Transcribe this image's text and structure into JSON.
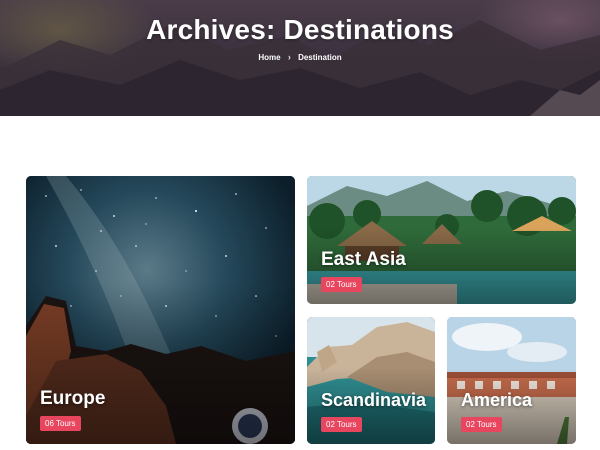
{
  "hero": {
    "title": "Archives: Destinations",
    "breadcrumb": {
      "home": "Home",
      "separator": "›",
      "current": "Destination"
    }
  },
  "destinations": [
    {
      "name": "Europe",
      "tours": "06 Tours"
    },
    {
      "name": "East Asia",
      "tours": "02 Tours"
    },
    {
      "name": "Scandinavia",
      "tours": "02 Tours"
    },
    {
      "name": "America",
      "tours": "02 Tours"
    }
  ],
  "colors": {
    "badge": "#e8455f",
    "hero_overlay": "#3c3240"
  }
}
